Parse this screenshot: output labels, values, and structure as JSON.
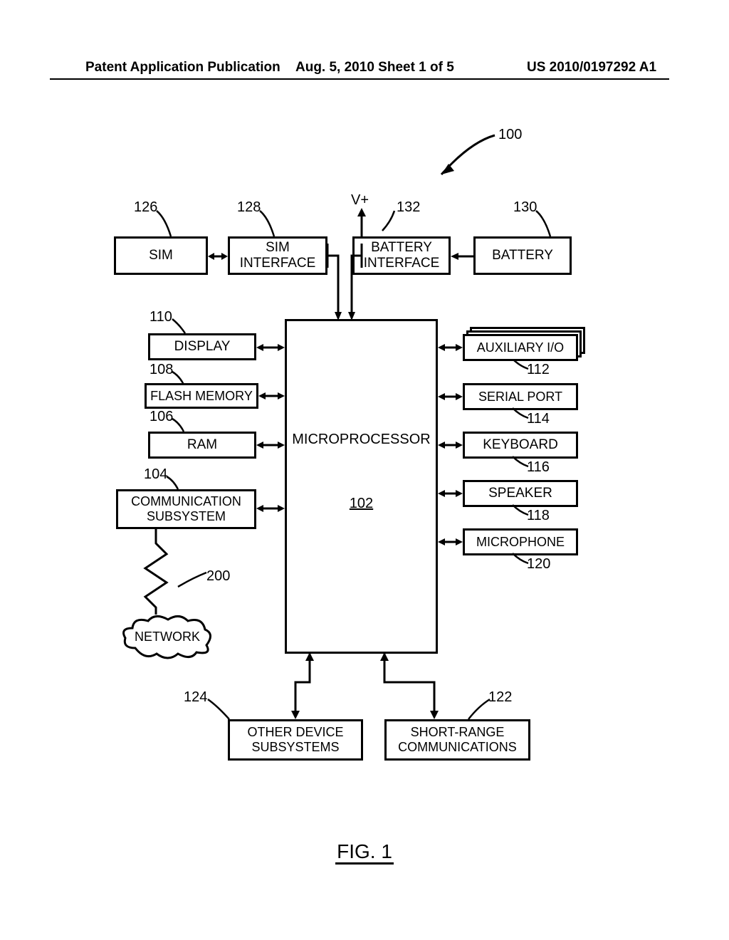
{
  "header": {
    "publication_text": "Patent Application Publication",
    "date_sheet": "Aug. 5, 2010  Sheet 1 of 5",
    "pub_number": "US 2010/0197292 A1"
  },
  "figure_label": "FIG. 1",
  "vplus": "V+",
  "labels": {
    "n100": "100",
    "n102": "102",
    "n104": "104",
    "n106": "106",
    "n108": "108",
    "n110": "110",
    "n112": "112",
    "n114": "114",
    "n116": "116",
    "n118": "118",
    "n120": "120",
    "n122": "122",
    "n124": "124",
    "n126": "126",
    "n128": "128",
    "n130": "130",
    "n132": "132",
    "n200": "200"
  },
  "boxes": {
    "sim": "SIM",
    "sim_iface": "SIM\nINTERFACE",
    "batt_iface": "BATTERY\nINTERFACE",
    "battery": "BATTERY",
    "display": "DISPLAY",
    "flash": "FLASH MEMORY",
    "ram": "RAM",
    "comm": "COMMUNICATION\nSUBSYSTEM",
    "micro": "MICROPROCESSOR",
    "aux": "AUXILIARY I/O",
    "serial": "SERIAL PORT",
    "keyboard": "KEYBOARD",
    "speaker": "SPEAKER",
    "mic": "MICROPHONE",
    "other": "OTHER DEVICE\nSUBSYSTEMS",
    "shortrange": "SHORT-RANGE\nCOMMUNICATIONS",
    "network": "NETWORK"
  }
}
